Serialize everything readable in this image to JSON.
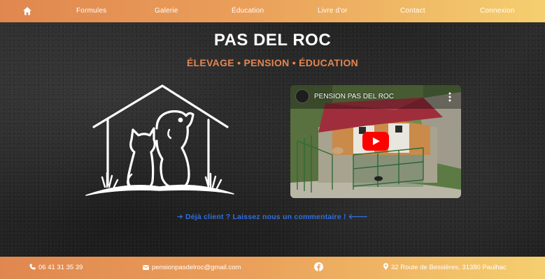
{
  "nav": {
    "home_icon": "home-icon",
    "links": [
      "Formules",
      "Galerie",
      "Éducation",
      "Livre d'or",
      "Contact",
      "Connexion"
    ]
  },
  "hero": {
    "title": "PAS DEL ROC",
    "subtitle": "ÉLEVAGE • PENSION • ÉDUCATION",
    "review_link": "➔ Déjà client ? Laissez nous un commentaire ! 🡐"
  },
  "video": {
    "title": "PENSION PAS DEL ROC",
    "play_icon": "youtube-play-icon"
  },
  "footer": {
    "phone": "06 41 31 35 39",
    "email": "pensionpasdelroc@gmail.com",
    "address": "32 Route de Bessières, 31380 Paulhac",
    "social_icon": "facebook-icon"
  },
  "colors": {
    "bar_gradient_start": "#e0874f",
    "bar_gradient_end": "#f5cf6f",
    "subtitle": "#e48651",
    "link": "#2f6fe0",
    "background": "#2a2a2a"
  }
}
